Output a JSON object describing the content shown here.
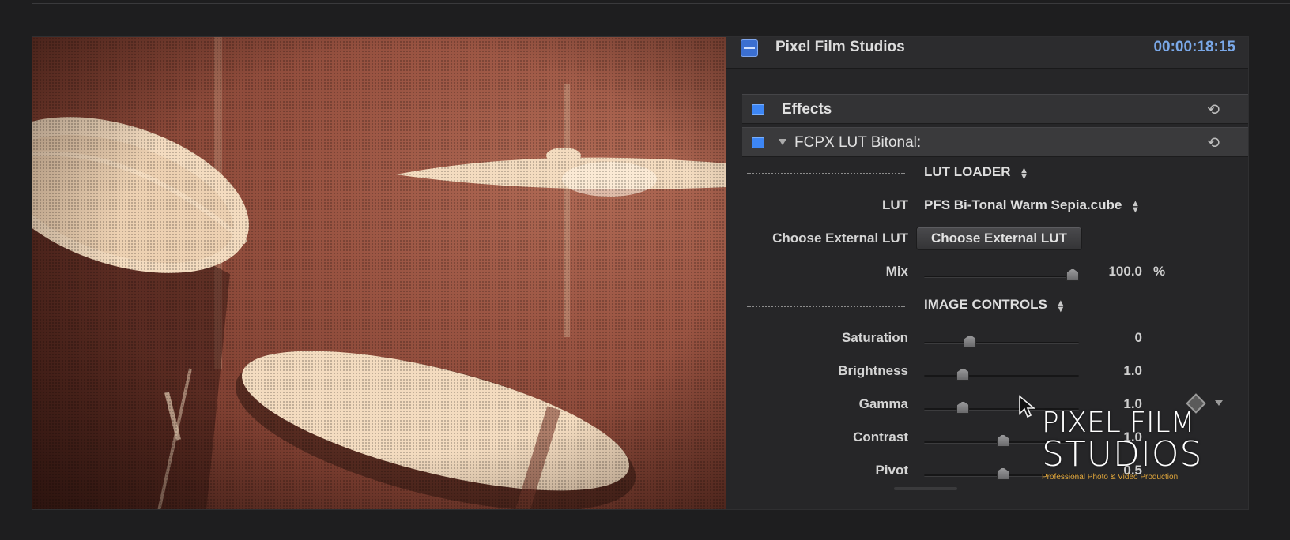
{
  "inspector": {
    "title": "Pixel Film Studios",
    "timecode": "00:00:18:15",
    "effects_label": "Effects",
    "effect_name": "FCPX LUT Bitonal:",
    "reset_glyph": "⟲"
  },
  "lut_loader": {
    "group_title": "LUT LOADER",
    "lut_label": "LUT",
    "lut_value": "PFS Bi-Tonal Warm Sepia.cube",
    "external_label": "Choose External LUT",
    "external_button": "Choose External LUT",
    "mix_label": "Mix",
    "mix_value": "100.0",
    "mix_unit": "%",
    "mix_level": 1.0
  },
  "image_controls": {
    "group_title": "IMAGE CONTROLS",
    "rows": [
      {
        "label": "Saturation",
        "value": "0",
        "level": 0.28
      },
      {
        "label": "Brightness",
        "value": "1.0",
        "level": 0.23
      },
      {
        "label": "Gamma",
        "value": "1.0",
        "level": 0.23
      },
      {
        "label": "Contrast",
        "value": "1.0",
        "level": 0.51
      },
      {
        "label": "Pivot",
        "value": "0.5",
        "level": 0.51
      }
    ]
  },
  "brand": {
    "line1": "PIXEL FILM",
    "line2": "STUDIOS",
    "tagline": "Professional Photo & Video Production"
  },
  "icons": {
    "header_icon": "inspector-panel-icon",
    "reset_icon": "reset-arrow-icon",
    "popup_icon": "up-down-arrows-icon",
    "keyframe_icon": "keyframe-diamond-icon",
    "cursor_icon": "mouse-pointer-icon"
  },
  "colors": {
    "accent_blue": "#3d86f5",
    "timecode_blue": "#7aa8e8",
    "sepia_dark": "#8a4636",
    "sepia_light": "#f4dcc0",
    "brand_orange": "#e2a73b"
  }
}
